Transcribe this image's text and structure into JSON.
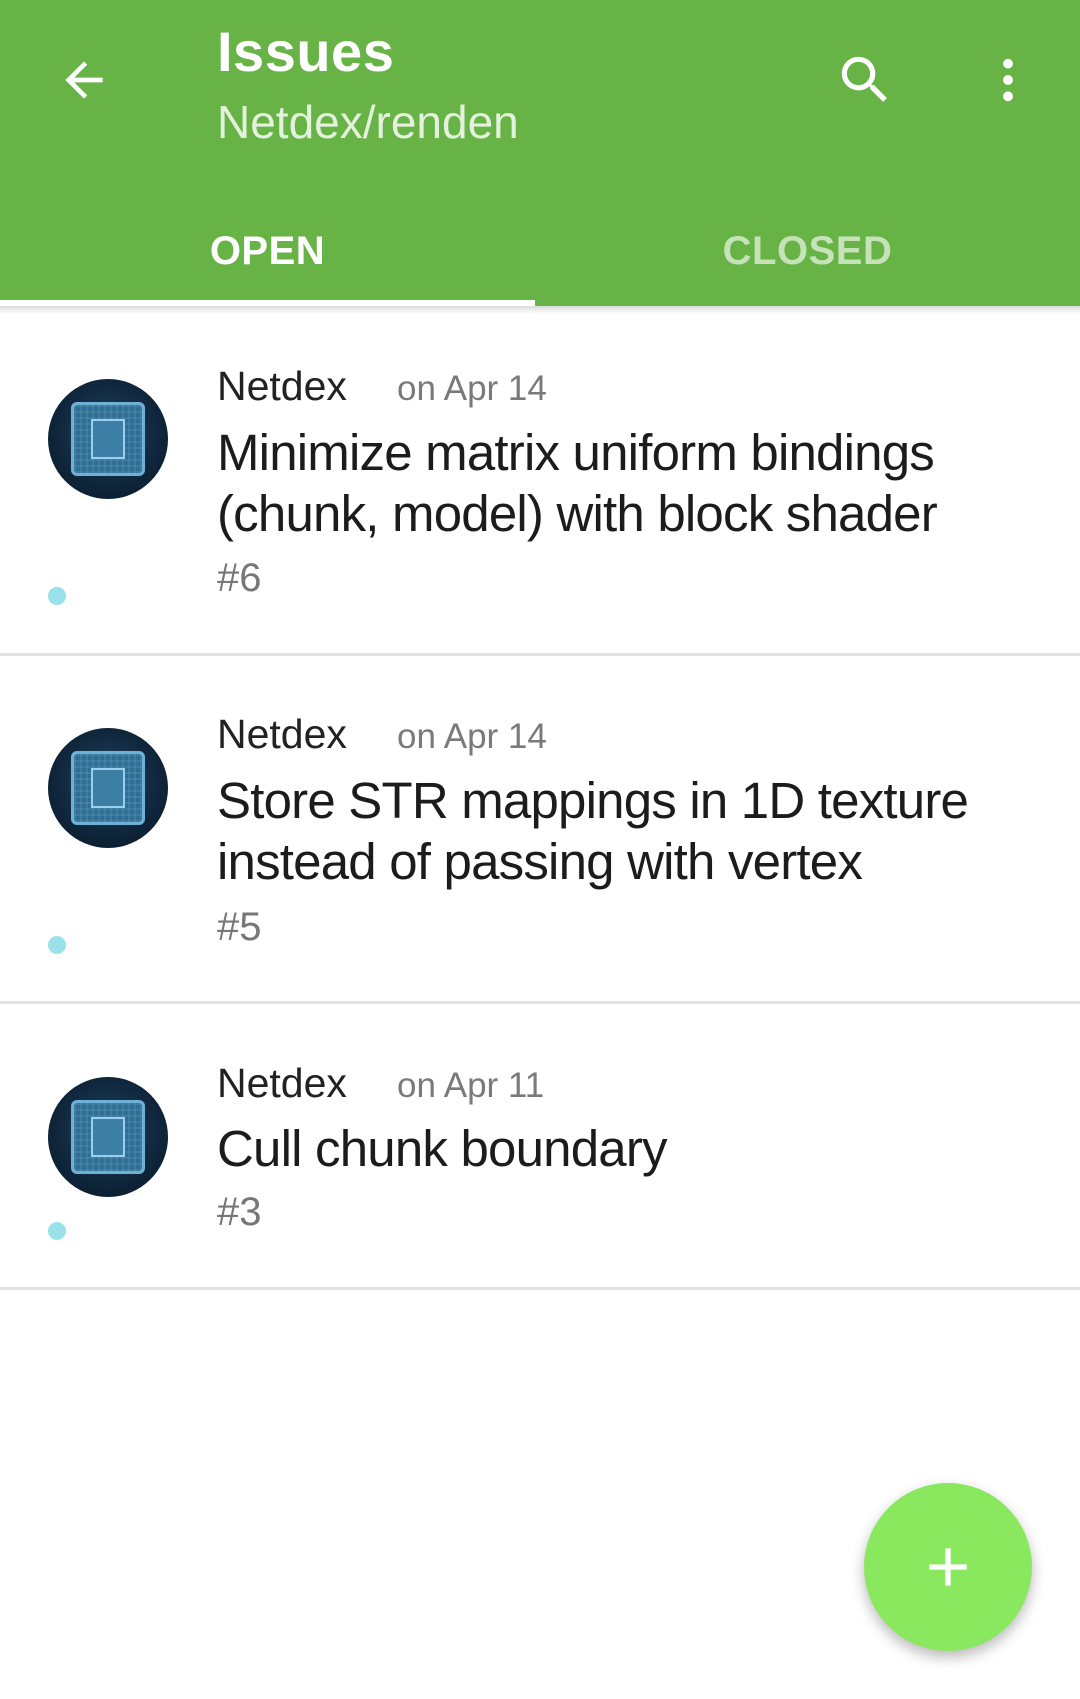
{
  "appbar": {
    "title": "Issues",
    "subtitle": "Netdex/renden",
    "icons": {
      "back": "arrow-back-icon",
      "search": "search-icon",
      "more": "more-vert-icon"
    },
    "color": "#67b346"
  },
  "tabs": [
    {
      "label": "OPEN",
      "selected": true
    },
    {
      "label": "CLOSED",
      "selected": false
    }
  ],
  "issues": [
    {
      "author": "Netdex",
      "date": "on Apr 14",
      "title": "Minimize matrix uniform bindings (chunk, model) with block shader",
      "number": "#6"
    },
    {
      "author": "Netdex",
      "date": "on Apr 14",
      "title": "Store STR mappings in 1D texture instead of passing with vertex",
      "number": "#5"
    },
    {
      "author": "Netdex",
      "date": "on Apr 11",
      "title": "Cull chunk boundary",
      "number": "#3"
    }
  ],
  "fab": {
    "icon": "plus-icon",
    "color": "#8ae85f"
  }
}
